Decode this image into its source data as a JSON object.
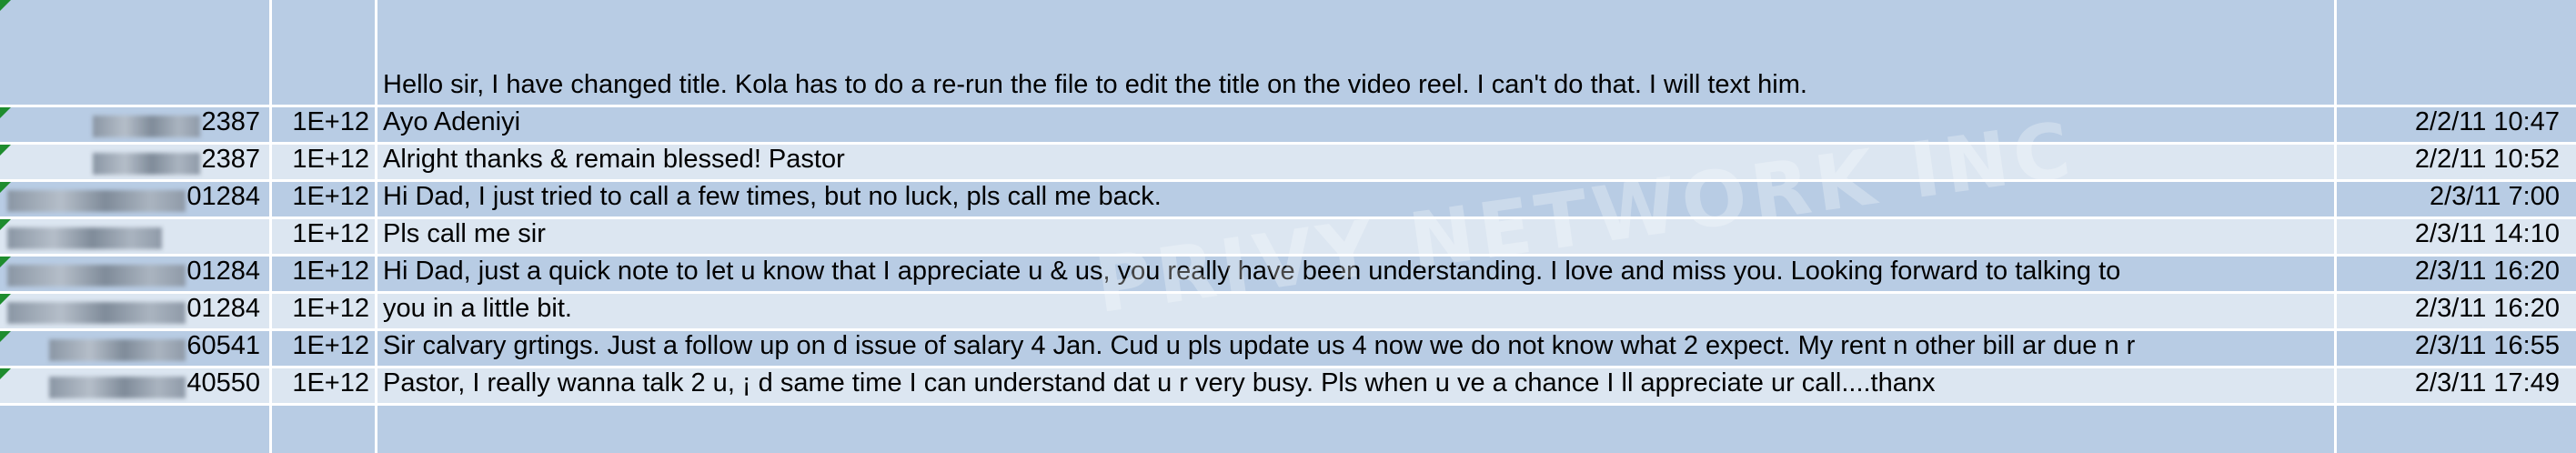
{
  "header_row": {
    "message": "Hello sir, I have changed title. Kola has to do a re-run the file to edit the title on the video reel. I can't do that. I will text him."
  },
  "rows": [
    {
      "phone_suffix": "2387",
      "number": "1E+12",
      "message": "Ayo Adeniyi",
      "datetime": "2/2/11 10:47"
    },
    {
      "phone_suffix": "2387",
      "number": "1E+12",
      "message": "Alright thanks & remain blessed! Pastor",
      "datetime": "2/2/11 10:52"
    },
    {
      "phone_suffix": "01284",
      "number": "1E+12",
      "message": "Hi Dad, I just tried to call a few times, but no luck, pls call me back.",
      "datetime": "2/3/11 7:00"
    },
    {
      "phone_suffix": "",
      "number": "1E+12",
      "message": "Pls call me sir",
      "datetime": "2/3/11 14:10"
    },
    {
      "phone_suffix": "01284",
      "number": "1E+12",
      "message": "Hi Dad, just a quick note to let u know that I appreciate u & us, you really have been understanding. I love and miss you. Looking forward to talking to",
      "datetime": "2/3/11 16:20"
    },
    {
      "phone_suffix": "01284",
      "number": "1E+12",
      "message": "you in a little bit.",
      "datetime": "2/3/11 16:20"
    },
    {
      "phone_suffix": "60541",
      "number": "1E+12",
      "message": "Sir calvary grtings. Just a follow up on d issue of salary 4 Jan. Cud u pls update us 4 now we do not know what 2 expect. My rent n other bill ar due n r",
      "datetime": "2/3/11 16:55"
    },
    {
      "phone_suffix": "40550",
      "number": "1E+12",
      "message": "Pastor, I really wanna talk 2 u, ¡ d same time I can understand dat u r very busy. Pls when u  ve a chance I ll appreciate ur call....thanx",
      "datetime": "2/3/11 17:49"
    }
  ],
  "watermark": "PRIVY NETWORK INC"
}
